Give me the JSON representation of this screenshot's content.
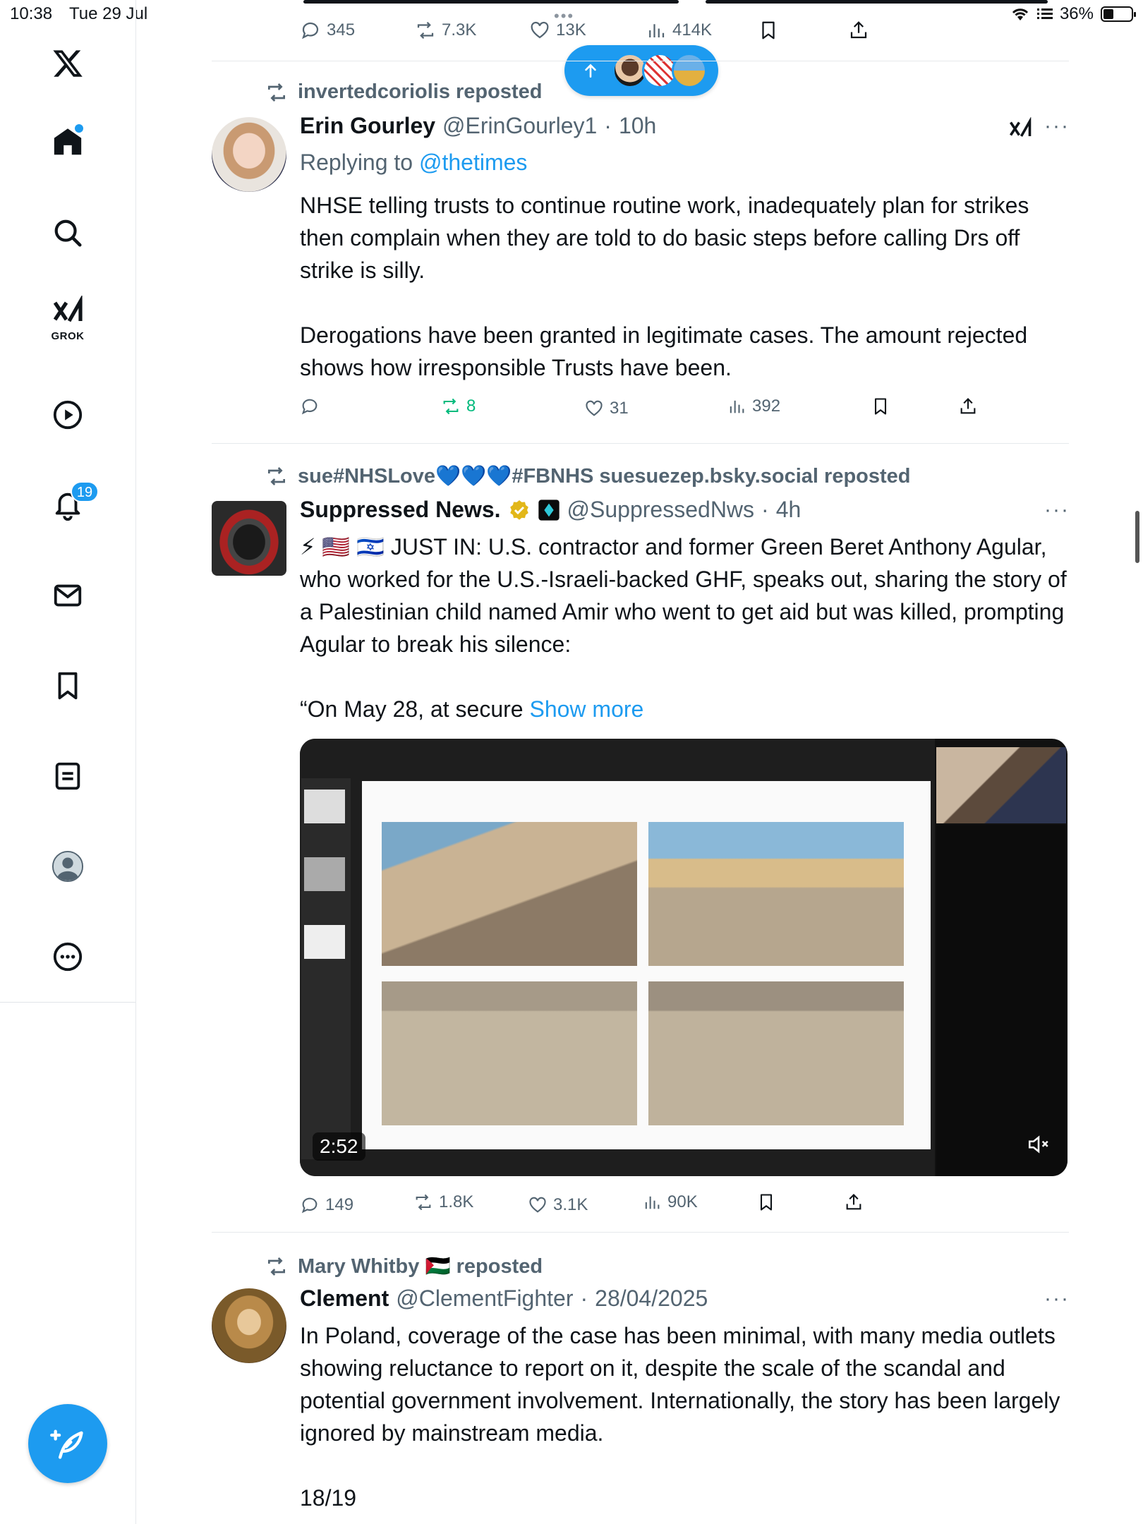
{
  "status_bar": {
    "time": "10:38",
    "date": "Tue 29 Jul",
    "battery": "36%"
  },
  "sidebar": {
    "grok_label": "GROK",
    "notifications_badge": "19"
  },
  "top_actions": {
    "replies": "345",
    "reposts": "7.3K",
    "likes": "13K",
    "views": "414K"
  },
  "tweets": [
    {
      "reposted_by": "invertedcoriolis reposted",
      "name": "Erin Gourley",
      "handle": "@ErinGourley1",
      "time": "10h",
      "replying_prefix": "Replying to",
      "replying_mention": "@thetimes",
      "text": "NHSE telling trusts to continue routine work, inadequately plan for strikes then complain when they are told to do basic steps before calling Drs off strike is silly.\n\nDerogations have been granted in legitimate cases. The amount rejected shows how irresponsible Trusts have been.",
      "replies": "",
      "reposts": "8",
      "likes": "31",
      "views": "392"
    },
    {
      "reposted_by": "sue#NHSLove💙💙💙#FBNHS suesuezep.bsky.social reposted",
      "name": "Suppressed News.",
      "handle": "@SuppressedNws",
      "time": "4h",
      "text": "⚡ 🇺🇸 🇮🇱 JUST IN: U.S. contractor and former Green Beret Anthony Agular, who worked for the U.S.-Israeli-backed GHF, speaks out, sharing the story of a Palestinian child named Amir who went to get aid but was killed, prompting Agular to break his silence:\n\n“On May 28, at secure ",
      "show_more": "Show more",
      "video_duration": "2:52",
      "replies": "149",
      "reposts": "1.8K",
      "likes": "3.1K",
      "views": "90K"
    },
    {
      "reposted_by": "Mary Whitby 🇵🇸 reposted",
      "name": "Clement",
      "handle": "@ClementFighter",
      "time": "28/04/2025",
      "text": "In Poland, coverage of the case has been minimal, with many media outlets showing reluctance to report on it, despite the scale of the scandal and potential government involvement. Internationally, the story has been largely ignored by mainstream media.\n\n18/19"
    }
  ]
}
